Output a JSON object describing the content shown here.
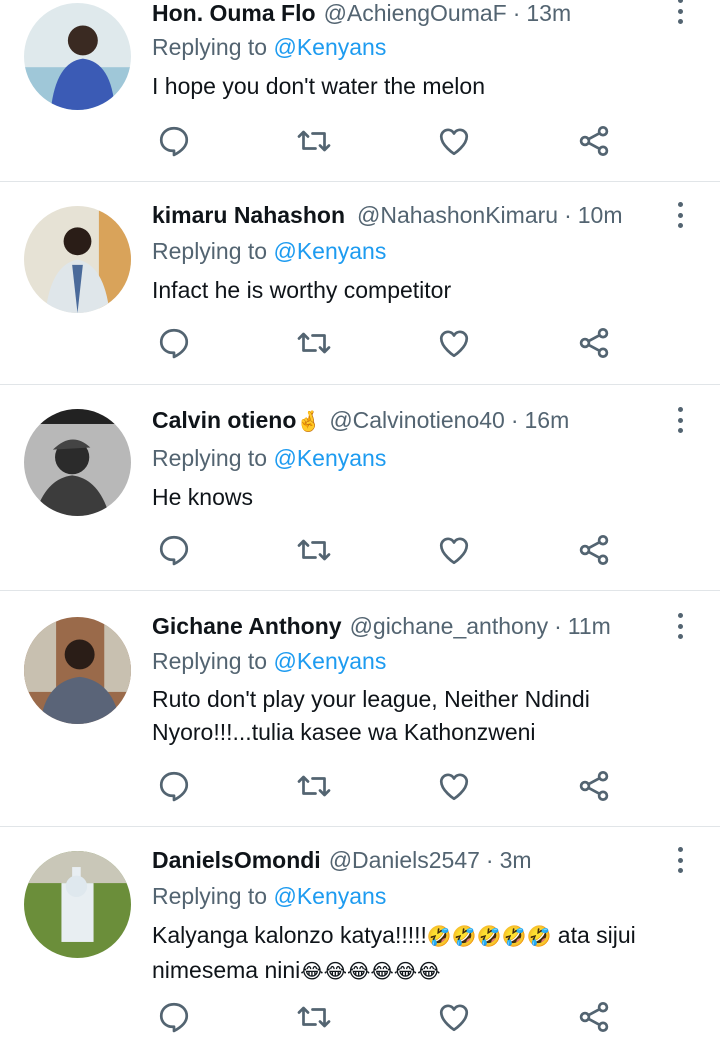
{
  "tweets": [
    {
      "name": "Hon. Ouma Flo",
      "handle": "@AchiengOumaF",
      "dot": "·",
      "time": "13m",
      "replying_prefix": "Replying to",
      "replying_to": "@Kenyans",
      "text": "I hope you don't water the melon",
      "avatar_color": "#3b5bb5"
    },
    {
      "name": "kimaru Nahashon",
      "handle": "@NahashonKimaru",
      "dot": "·",
      "time": "10m",
      "replying_prefix": "Replying to",
      "replying_to": "@Kenyans",
      "text": "Infact he is worthy competitor",
      "avatar_color": "#cbd5d8"
    },
    {
      "name": "Calvin otieno",
      "name_emoji": "🤞",
      "handle": "@Calvinotieno40",
      "dot": "·",
      "time": "16m",
      "replying_prefix": "Replying to",
      "replying_to": "@Kenyans",
      "text": "He knows",
      "avatar_color": "#8a8a8a"
    },
    {
      "name": "Gichane Anthony",
      "handle": "@gichane_anthony",
      "dot": "·",
      "time": "11m",
      "replying_prefix": "Replying to",
      "replying_to": "@Kenyans",
      "text_line1": "Ruto don't play your league, Neither Ndindi",
      "text_line2": "Nyoro!!!...tulia kasee wa Kathonzweni",
      "avatar_color": "#7a5a3f"
    },
    {
      "name": "DanielsOmondi",
      "handle": "@Daniels2547",
      "dot": "·",
      "time": "3m",
      "replying_prefix": "Replying to",
      "replying_to": "@Kenyans",
      "text_line1": "Kalyanga kalonzo katya!!!!!",
      "emoji_line1": "🤣🤣🤣🤣🤣",
      "text_line1b": " ata sijui",
      "text_line2": "nimesema nini",
      "emoji_line2": "😂😂😂😂😂😂",
      "avatar_color": "#5f7f3b"
    }
  ],
  "icons": {
    "reply": "reply-icon",
    "retweet": "retweet-icon",
    "like": "heart-icon",
    "share": "share-icon",
    "more": "more-vertical-icon"
  },
  "colors": {
    "secondary_text": "#536471",
    "link": "#1d9bf0",
    "divider": "#e1e5e8"
  }
}
